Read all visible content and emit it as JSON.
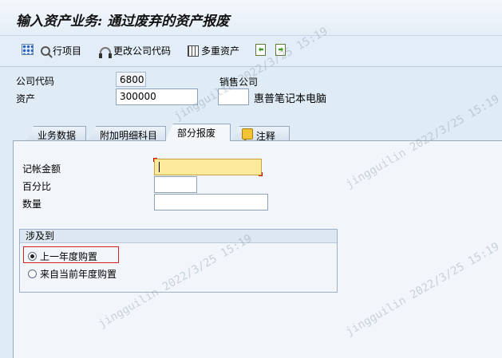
{
  "window": {
    "title": "输入资产业务: 通过废弃的资产报废"
  },
  "toolbar": {
    "line_items": "行项目",
    "change_company": "更改公司代码",
    "multi_assets": "多重资产"
  },
  "header": {
    "company_code_label": "公司代码",
    "company_code_value": "6800",
    "asset_label": "资产",
    "asset_value": "300000",
    "sub_number_value": "",
    "asset_description": "惠普笔记本电脑",
    "sales_company_label": "销售公司"
  },
  "tabs": [
    {
      "label": "业务数据"
    },
    {
      "label": "附加明细科目"
    },
    {
      "label": "部分报废"
    },
    {
      "label": "注释"
    }
  ],
  "form": {
    "amount_label": "记帐金额",
    "amount_value": "",
    "percent_label": "百分比",
    "percent_value": "",
    "quantity_label": "数量",
    "quantity_value": ""
  },
  "group": {
    "title": "涉及到",
    "option1": "上一年度购置",
    "option2": "来自当前年度购置",
    "selected": "option1"
  },
  "watermark": "jingguilin 2022/3/25 15:19"
}
